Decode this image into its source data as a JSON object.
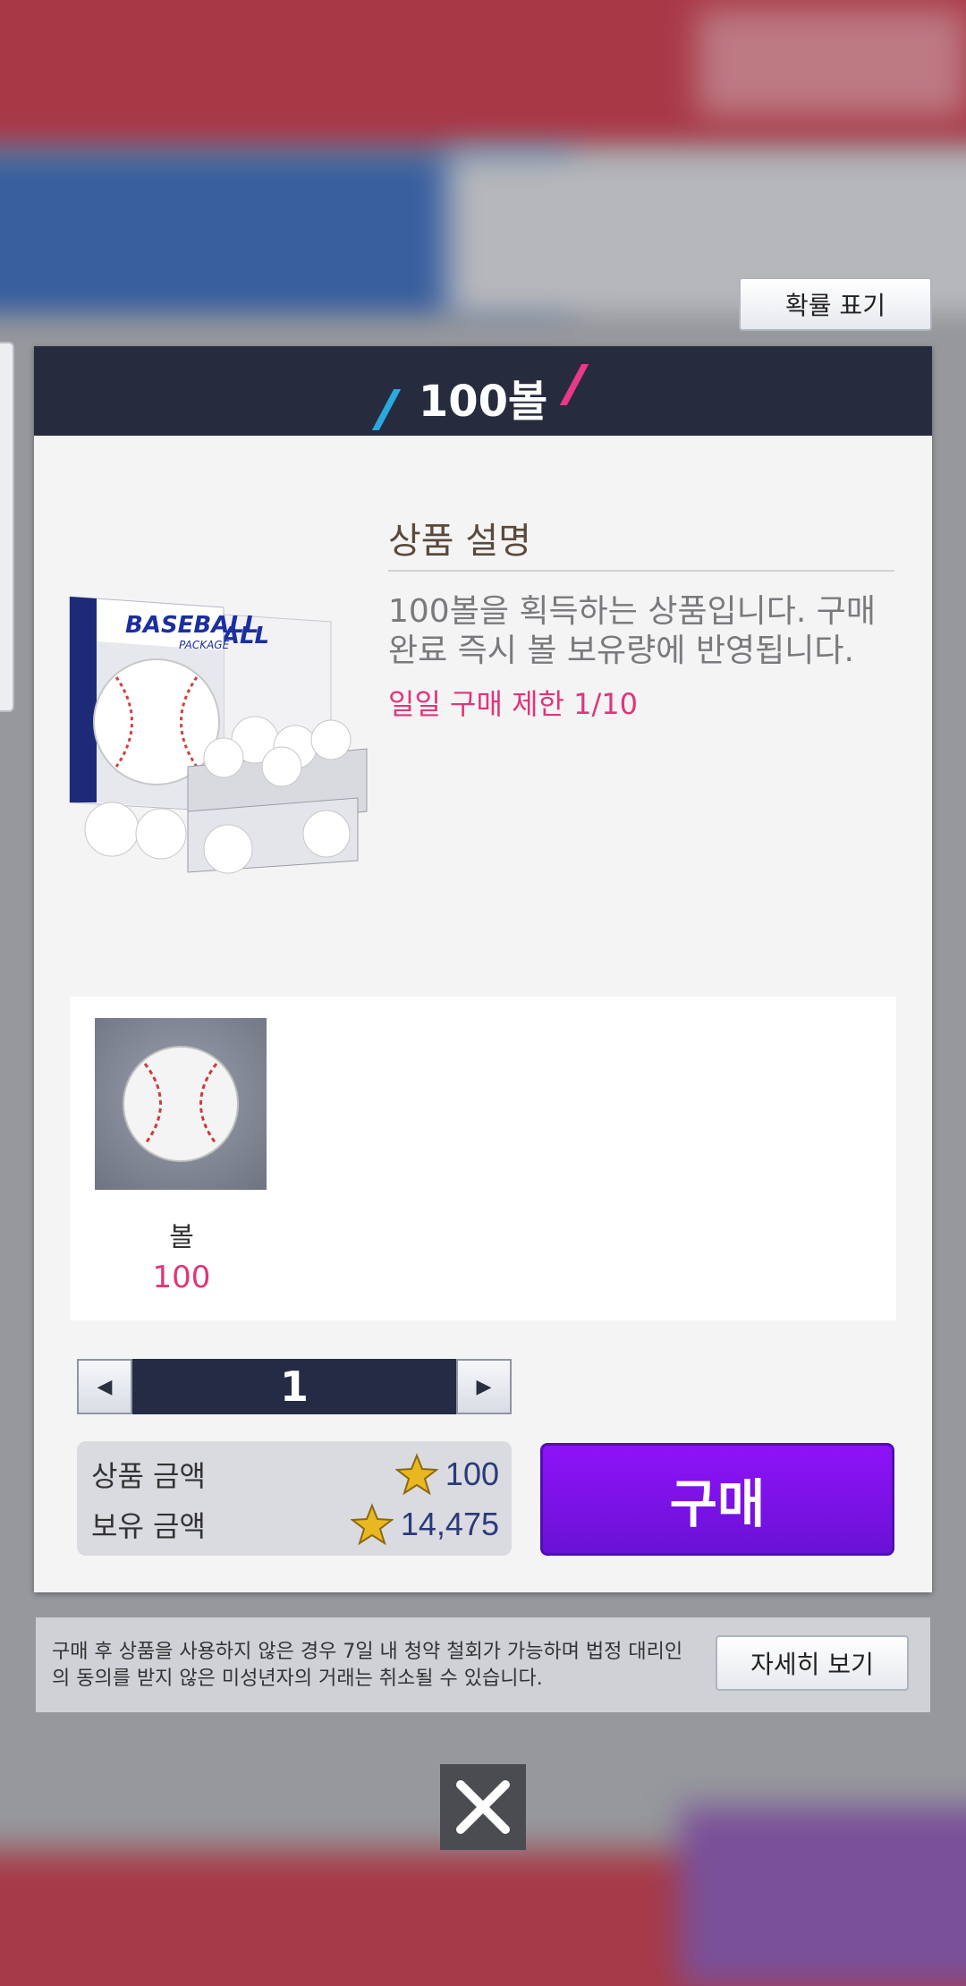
{
  "header_button": {
    "probability_label": "확률 표기"
  },
  "dialog": {
    "title": "100볼",
    "description_title": "상품 설명",
    "description_text": "100볼을 획득하는 상품입니다. 구매 완료 즉시 볼 보유량에 반영됩니다.",
    "purchase_limit": "일일 구매 제한 1/10",
    "product_image": {
      "icon": "baseball-package-icon",
      "label_front": "BASEBALL",
      "label_sub": "PACKAGE",
      "label_back": "BALL"
    },
    "rewards": [
      {
        "name": "볼",
        "count": "100",
        "icon": "baseball-icon"
      }
    ],
    "quantity": {
      "value": "1",
      "decrease_symbol": "◀",
      "increase_symbol": "▶"
    },
    "price": {
      "product_price_label": "상품 금액",
      "product_price_value": "100",
      "owned_amount_label": "보유 금액",
      "owned_amount_value": "14,475",
      "currency_icon": "star-icon"
    },
    "buy_label": "구매"
  },
  "notice": {
    "text": "구매 후 상품을 사용하지 않은 경우 7일 내 청약 철회가 가능하며 법정 대리인의 동의를 받지 않은 미성년자의 거래는 취소될 수 있습니다.",
    "detail_label": "자세히 보기"
  },
  "close_icon": "close-icon",
  "colors": {
    "header_bg": "#262b3d",
    "accent_pink": "#e0357a",
    "buy_purple": "#7a12e8",
    "price_text": "#2a3a7a"
  }
}
